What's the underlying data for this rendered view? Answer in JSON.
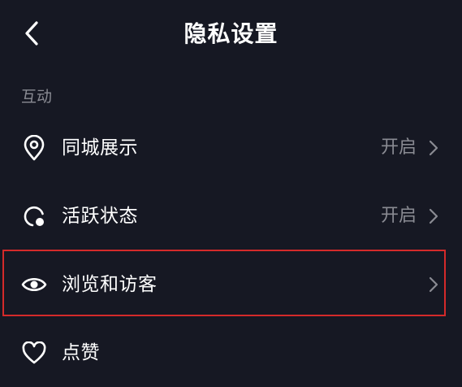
{
  "header": {
    "title": "隐私设置",
    "back_icon": "chevron-left-icon"
  },
  "section": {
    "title": "互动"
  },
  "rows": [
    {
      "label": "同城展示",
      "value": "开启",
      "icon": "location-pin-icon"
    },
    {
      "label": "活跃状态",
      "value": "开启",
      "icon": "activity-status-icon"
    },
    {
      "label": "浏览和访客",
      "value": "",
      "icon": "eye-icon",
      "highlighted": true
    },
    {
      "label": "点赞",
      "value": "",
      "icon": "heart-icon"
    }
  ],
  "colors": {
    "background": "#161823",
    "text_primary": "#ffffff",
    "text_secondary": "#8a8b93",
    "highlight": "#d42a2a"
  }
}
